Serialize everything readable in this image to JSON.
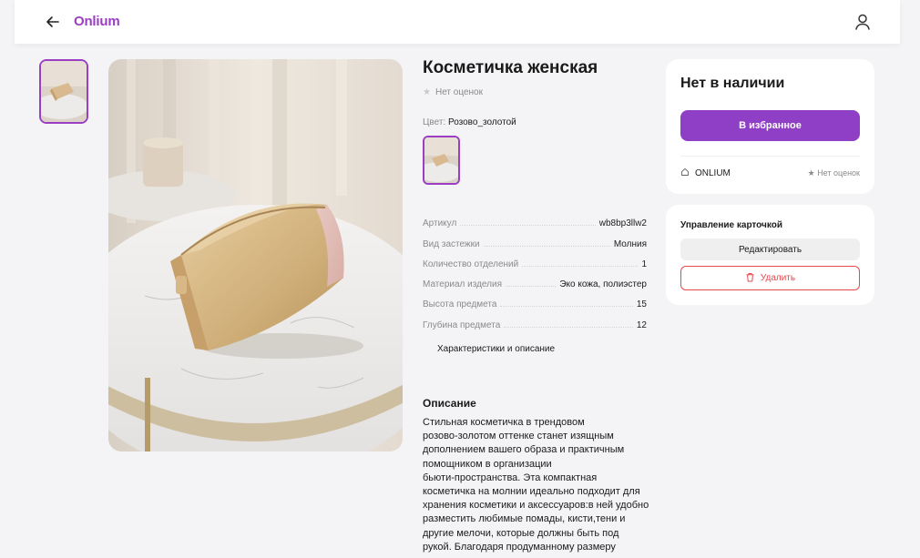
{
  "header": {
    "logo": "Onlium"
  },
  "product": {
    "title": "Косметичка женская",
    "rating_text": "Нет оценок",
    "color_label": "Цвет:",
    "color_value": "Розово_золотой",
    "specs": [
      {
        "key": "Артикул",
        "value": "wb8bp3llw2"
      },
      {
        "key": "Вид застежки",
        "value": "Молния"
      },
      {
        "key": "Количество отделений",
        "value": "1"
      },
      {
        "key": "Материал изделия",
        "value": "Эко кожа, полиэстер"
      },
      {
        "key": "Высота предмета",
        "value": "15"
      },
      {
        "key": "Глубина предмета",
        "value": "12"
      }
    ],
    "chars_link": "Характеристики и описание",
    "description_title": "Описание",
    "description": "Стильная косметичка в трендовом\nрозово-золотом оттенке станет изящным\nдополнением вашего образа и практичным\nпомощником в организации\nбьюти-пространства. Эта компактная\nкосметичка на молнии идеально подходит для\nхранения косметики и аксессуаров:в ней удобно\nразместить любимые помады, кисти,тени и\nдругие мелочи, которые должны быть под\nрукой. Благодаря продуманному размеру"
  },
  "buy_card": {
    "stock_status": "Нет в наличии",
    "favorite_button": "В избранное",
    "seller_name": "ONLIUM",
    "seller_rating": "Нет оценок"
  },
  "manage_card": {
    "title": "Управление карточкой",
    "edit_button": "Редактировать",
    "delete_button": "Удалить"
  },
  "colors": {
    "accent": "#8e3fc5",
    "logo": "#9b3ec4",
    "danger": "#e5484d",
    "background": "#f4f4f6"
  }
}
